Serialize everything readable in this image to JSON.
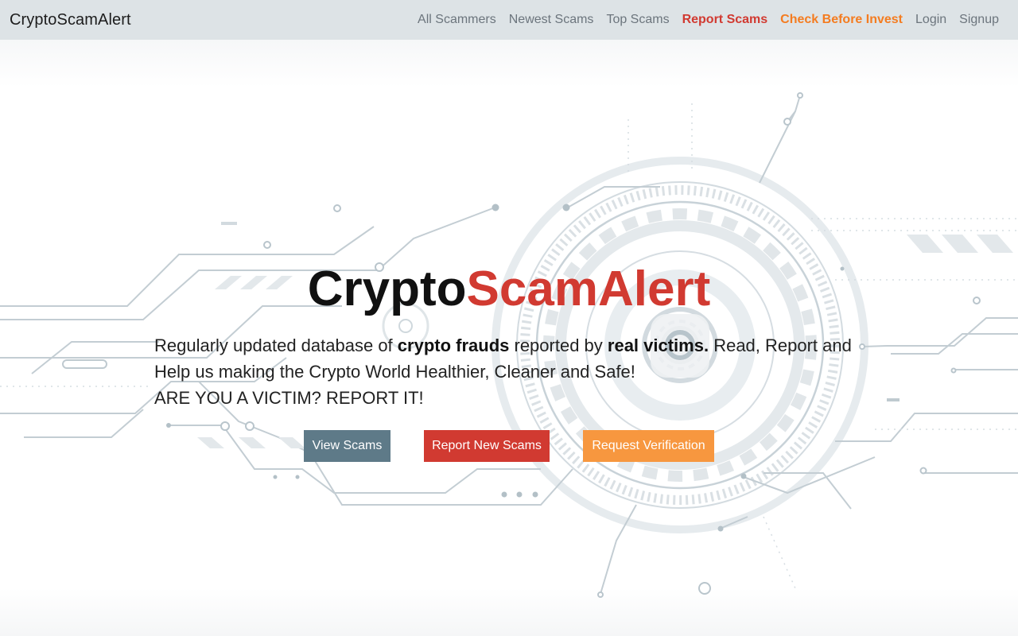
{
  "brand": "CryptoScamAlert",
  "nav": {
    "all_scammers": "All Scammers",
    "newest_scams": "Newest Scams",
    "top_scams": "Top Scams",
    "report_scams": "Report Scams",
    "check_before_invest": "Check Before Invest",
    "login": "Login",
    "signup": "Signup"
  },
  "hero": {
    "title_part1": "Crypto",
    "title_part2": "ScamAlert",
    "desc_1": "Regularly updated database of ",
    "desc_bold_1": "crypto frauds",
    "desc_2": " reported by ",
    "desc_bold_2": "real victims.",
    "desc_3": " Read, Report and Help us making the Crypto World Healthier, Cleaner and Safe!",
    "desc_4": "ARE YOU A VICTIM? REPORT IT!"
  },
  "buttons": {
    "view": "View Scams",
    "report": "Report New Scams",
    "verify": "Request Verification"
  },
  "colors": {
    "accent_red": "#d13a31",
    "accent_orange": "#f47c20",
    "button_gray_blue": "#5e7a88",
    "button_orange": "#f7973f",
    "navbar_bg": "#dde3e6"
  }
}
